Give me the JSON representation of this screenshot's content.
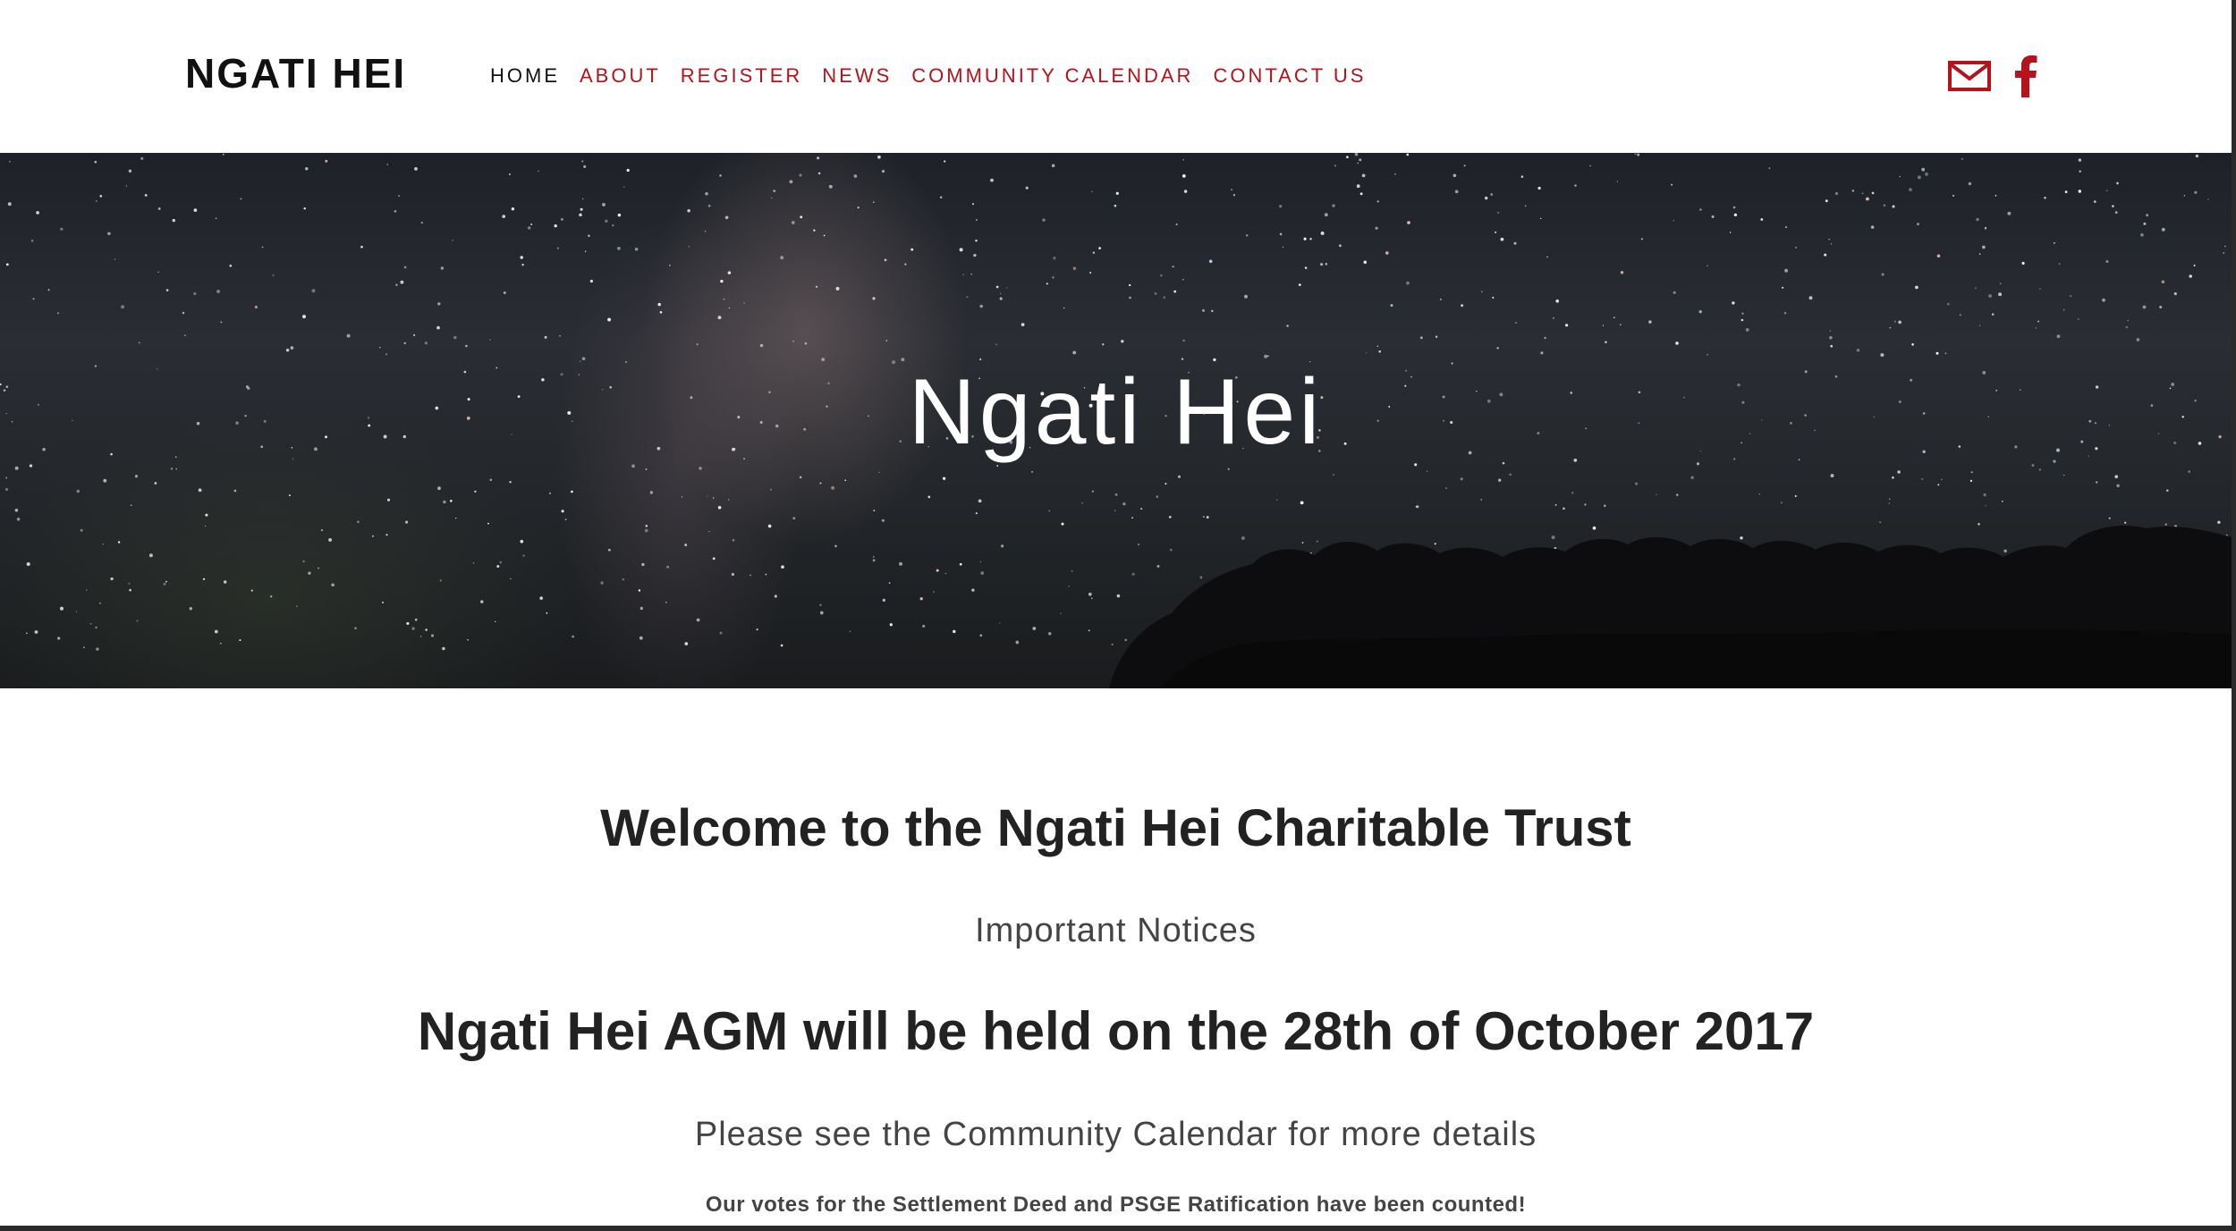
{
  "header": {
    "logo": "NGATI HEI",
    "nav": [
      {
        "label": "HOME",
        "active": true
      },
      {
        "label": "ABOUT",
        "active": false
      },
      {
        "label": "REGISTER",
        "active": false
      },
      {
        "label": "NEWS",
        "active": false
      },
      {
        "label": "COMMUNITY CALENDAR",
        "active": false
      },
      {
        "label": "CONTACT US",
        "active": false
      }
    ],
    "social": [
      {
        "icon": "mail-icon"
      },
      {
        "icon": "facebook-icon"
      }
    ]
  },
  "hero": {
    "title": "Ngati Hei"
  },
  "main": {
    "welcome": "Welcome to the Ngati Hei Charitable Trust",
    "notices": "Important Notices",
    "agm": "Ngati Hei AGM will be held on the 28th of October 2017",
    "calendar_note": "Please see the Community Calendar for more details",
    "votes": "Our votes for the Settlement Deed and PSGE Ratification have been counted!"
  },
  "colors": {
    "accent": "#b5121b",
    "text_dark": "#222222",
    "text_muted": "#444444",
    "hero_bg": "#23262a"
  }
}
